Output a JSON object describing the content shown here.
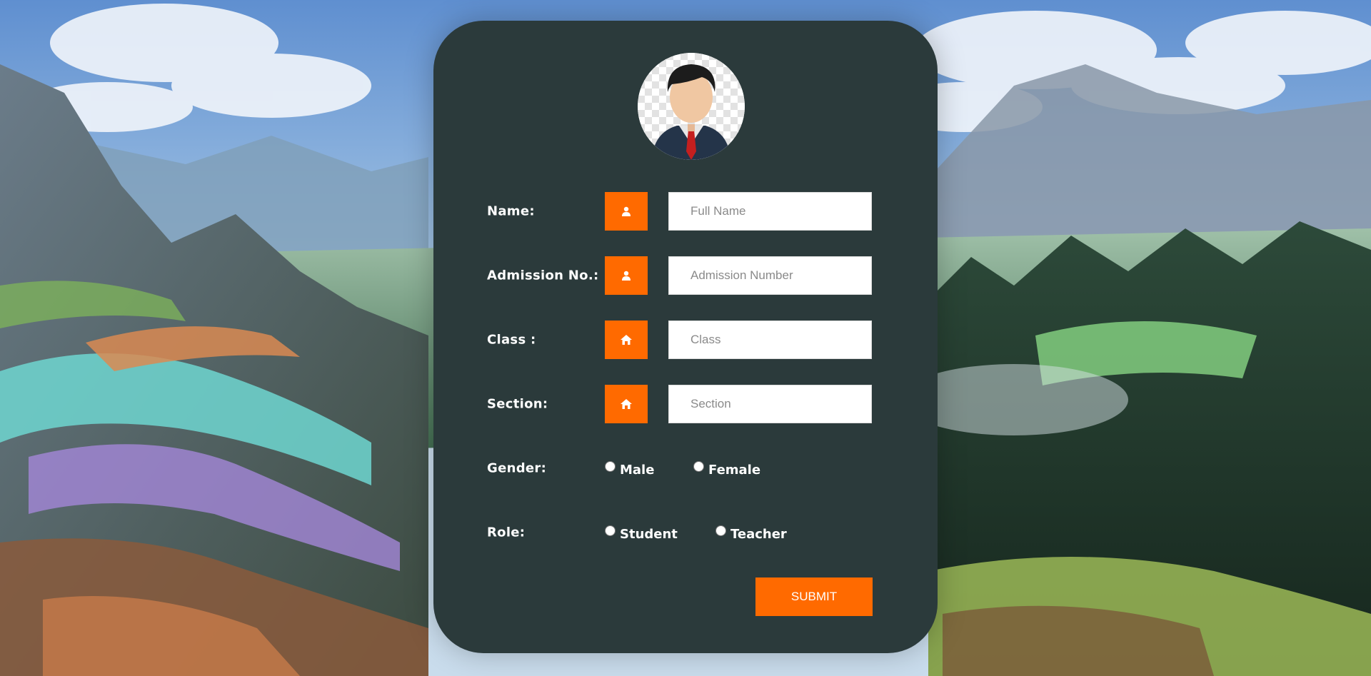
{
  "form": {
    "fields": [
      {
        "label": "Name:",
        "icon": "user-icon",
        "placeholder": "Full Name"
      },
      {
        "label": "Admission No.:",
        "icon": "user-icon",
        "placeholder": "Admission Number"
      },
      {
        "label": "Class :",
        "icon": "home-icon",
        "placeholder": "Class"
      },
      {
        "label": "Section:",
        "icon": "home-icon",
        "placeholder": "Section"
      }
    ],
    "gender": {
      "label": "Gender:",
      "options": [
        "Male",
        "Female"
      ]
    },
    "role": {
      "label": "Role:",
      "options": [
        "Student",
        "Teacher"
      ]
    },
    "submit_label": "SUBMIT"
  },
  "colors": {
    "accent": "#ff6a00",
    "card": "#2b3a3b",
    "text": "#ffffff"
  }
}
